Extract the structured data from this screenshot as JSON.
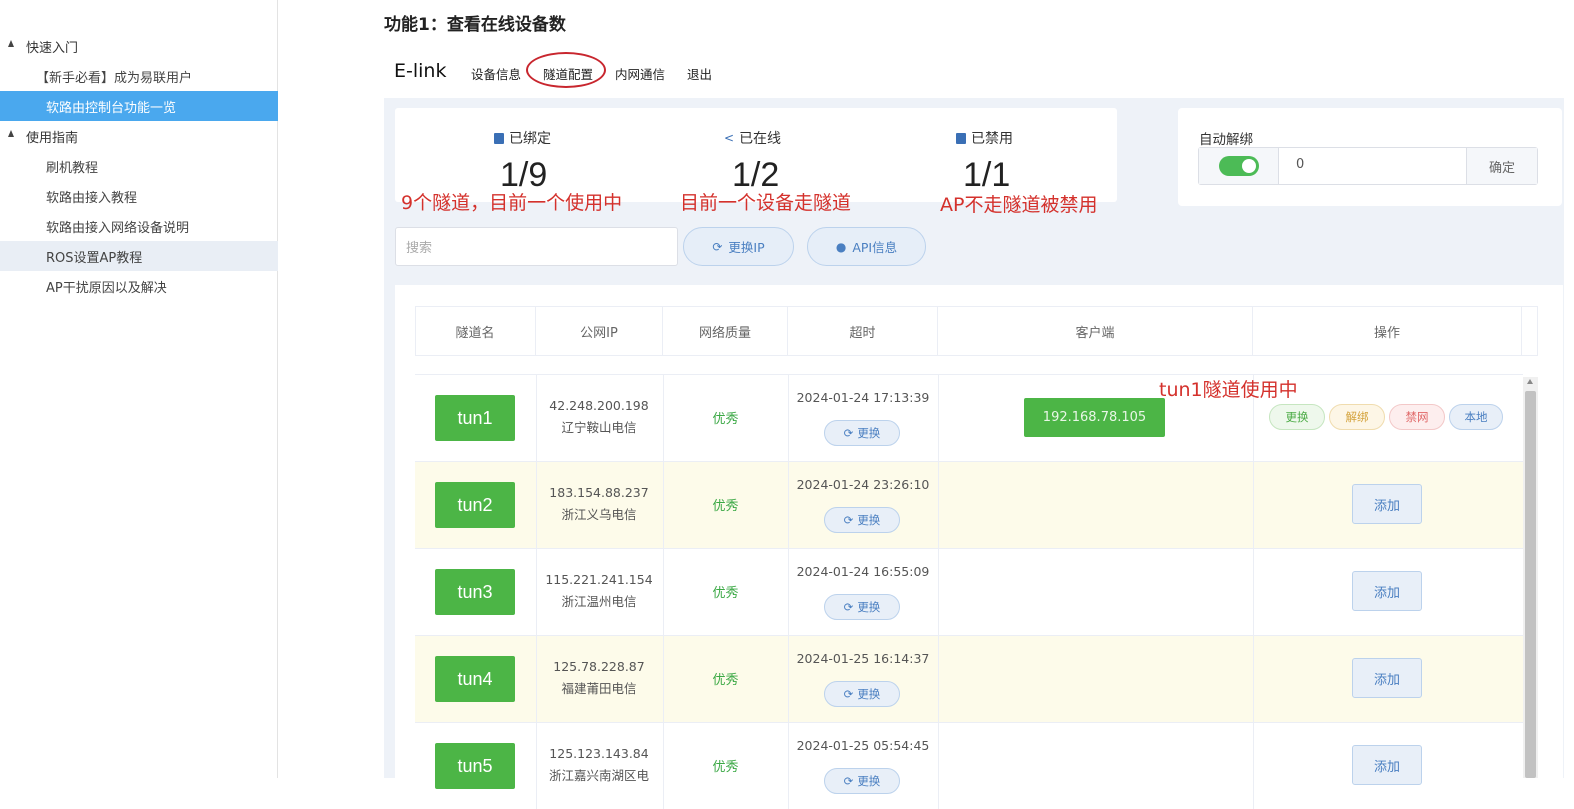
{
  "sidebar": {
    "groups": [
      {
        "label": "快速入门"
      },
      {
        "label": "使用指南"
      }
    ],
    "items": [
      {
        "label": "【新手必看】成为易联用户"
      },
      {
        "label": "软路由控制台功能一览"
      },
      {
        "label": "刷机教程"
      },
      {
        "label": "软路由接入教程"
      },
      {
        "label": "软路由接入网络设备说明"
      },
      {
        "label": "ROS设置AP教程"
      },
      {
        "label": "AP干扰原因以及解决"
      }
    ]
  },
  "page_title": "功能1：查看在线设备数",
  "topbar": {
    "brand": "E-link",
    "nav": [
      "设备信息",
      "隧道配置",
      "内网通信",
      "退出"
    ]
  },
  "stats": [
    {
      "label": "已绑定",
      "value": "1/9",
      "annotation": "9个隧道，目前一个使用中"
    },
    {
      "label": "已在线",
      "value": "1/2",
      "annotation": "目前一个设备走隧道"
    },
    {
      "label": "已禁用",
      "value": "1/1",
      "annotation": "AP不走隧道被禁用"
    }
  ],
  "auto_unbind": {
    "label": "自动解绑",
    "toggle_on": true,
    "value": "0",
    "confirm": "确定"
  },
  "search": {
    "placeholder": "搜索"
  },
  "actions": {
    "change_ip": "更换IP",
    "api_info": "API信息"
  },
  "table": {
    "headers": [
      "隧道名",
      "公网IP",
      "网络质量",
      "超时",
      "客户端",
      "操作"
    ],
    "annotation": "tun1隧道使用中",
    "change_label": "更换",
    "add_label": "添加",
    "ops": [
      "更换",
      "解绑",
      "禁网",
      "本地"
    ],
    "rows": [
      {
        "name": "tun1",
        "ip": "42.248.200.198",
        "location": "辽宁鞍山电信",
        "quality": "优秀",
        "timeout": "2024-01-24 17:13:39",
        "client": "192.168.78.105"
      },
      {
        "name": "tun2",
        "ip": "183.154.88.237",
        "location": "浙江义乌电信",
        "quality": "优秀",
        "timeout": "2024-01-24 23:26:10",
        "client": ""
      },
      {
        "name": "tun3",
        "ip": "115.221.241.154",
        "location": "浙江温州电信",
        "quality": "优秀",
        "timeout": "2024-01-24 16:55:09",
        "client": ""
      },
      {
        "name": "tun4",
        "ip": "125.78.228.87",
        "location": "福建莆田电信",
        "quality": "优秀",
        "timeout": "2024-01-25 16:14:37",
        "client": ""
      },
      {
        "name": "tun5",
        "ip": "125.123.143.84",
        "location": "浙江嘉兴南湖区电",
        "quality": "优秀",
        "timeout": "2024-01-25 05:54:45",
        "client": ""
      }
    ]
  },
  "colors": {
    "sidebar_active": "#4aa8ee",
    "tunnel_tag": "#4cb546",
    "annotation_red": "#d4312c",
    "quality_green": "#3aa844",
    "link_blue": "#4a7fc1"
  }
}
